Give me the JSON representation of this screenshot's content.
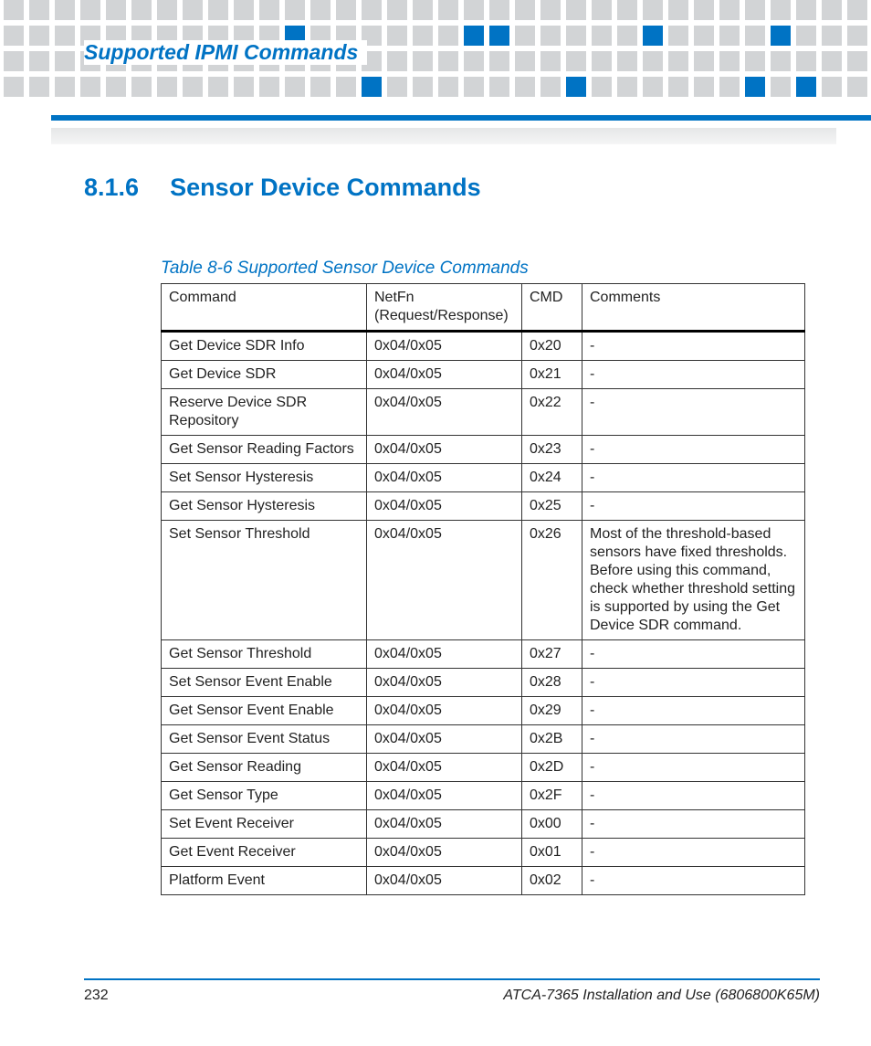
{
  "header": {
    "running_head": "Supported IPMI Commands"
  },
  "section": {
    "number": "8.1.6",
    "title": "Sensor Device Commands"
  },
  "table": {
    "caption": "Table 8-6 Supported Sensor Device Commands",
    "headers": {
      "command": "Command",
      "netfn": "NetFn (Request/Response)",
      "cmd": "CMD",
      "comments": "Comments"
    },
    "rows": [
      {
        "command": "Get Device SDR Info",
        "netfn": "0x04/0x05",
        "cmd": "0x20",
        "comments": "-"
      },
      {
        "command": "Get Device SDR",
        "netfn": "0x04/0x05",
        "cmd": "0x21",
        "comments": "-"
      },
      {
        "command": "Reserve Device SDR Repository",
        "netfn": "0x04/0x05",
        "cmd": "0x22",
        "comments": "-"
      },
      {
        "command": "Get Sensor Reading Factors",
        "netfn": "0x04/0x05",
        "cmd": "0x23",
        "comments": "-"
      },
      {
        "command": "Set Sensor Hysteresis",
        "netfn": "0x04/0x05",
        "cmd": "0x24",
        "comments": "-"
      },
      {
        "command": "Get Sensor Hysteresis",
        "netfn": "0x04/0x05",
        "cmd": "0x25",
        "comments": "-"
      },
      {
        "command": "Set Sensor Threshold",
        "netfn": "0x04/0x05",
        "cmd": "0x26",
        "comments": "Most of the threshold-based sensors have fixed thresholds. Before using this command, check whether threshold setting is supported by using the  Get Device SDR command."
      },
      {
        "command": "Get Sensor Threshold",
        "netfn": "0x04/0x05",
        "cmd": "0x27",
        "comments": "-"
      },
      {
        "command": "Set Sensor Event Enable",
        "netfn": "0x04/0x05",
        "cmd": "0x28",
        "comments": "-"
      },
      {
        "command": "Get Sensor Event Enable",
        "netfn": "0x04/0x05",
        "cmd": "0x29",
        "comments": "-"
      },
      {
        "command": "Get Sensor Event Status",
        "netfn": "0x04/0x05",
        "cmd": "0x2B",
        "comments": "-"
      },
      {
        "command": "Get Sensor Reading",
        "netfn": "0x04/0x05",
        "cmd": "0x2D",
        "comments": "-"
      },
      {
        "command": "Get Sensor Type",
        "netfn": "0x04/0x05",
        "cmd": "0x2F",
        "comments": "-"
      },
      {
        "command": "Set Event Receiver",
        "netfn": "0x04/0x05",
        "cmd": "0x00",
        "comments": "-"
      },
      {
        "command": "Get Event Receiver",
        "netfn": "0x04/0x05",
        "cmd": "0x01",
        "comments": "-"
      },
      {
        "command": "Platform Event",
        "netfn": "0x04/0x05",
        "cmd": "0x02",
        "comments": "-"
      }
    ]
  },
  "footer": {
    "page": "232",
    "doc": "ATCA-7365 Installation and Use (6806800K65M)"
  }
}
